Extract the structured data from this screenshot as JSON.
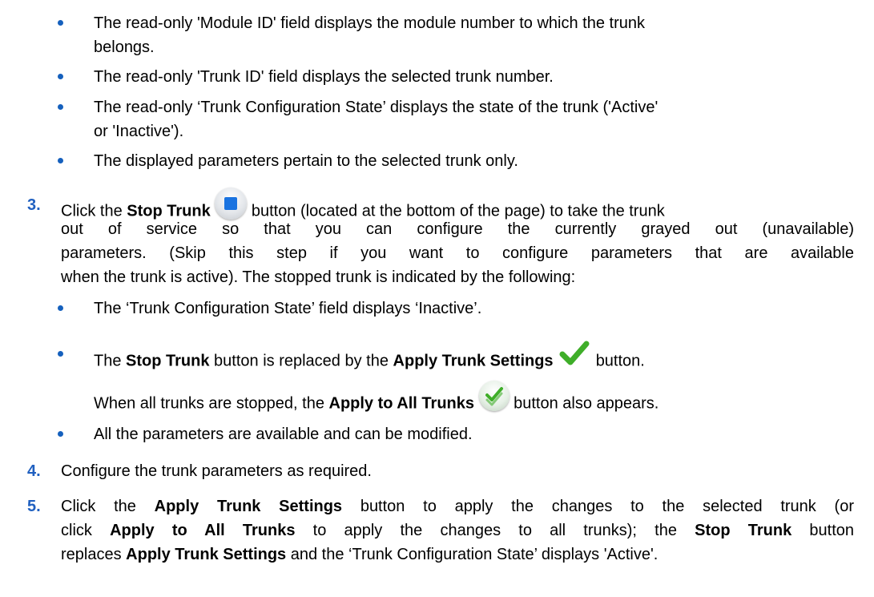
{
  "step2_bullets": {
    "b1_l1": "The read-only 'Module ID' field displays the module number to which the trunk",
    "b1_l2": "belongs.",
    "b2": "The read-only 'Trunk ID' field displays the selected trunk number.",
    "b3_l1": "The read-only ‘Trunk Configuration State’ displays the state of the trunk ('Active'",
    "b3_l2": "or 'Inactive').",
    "b4": "The displayed parameters pertain to the selected trunk only."
  },
  "step3": {
    "number": "3.",
    "pre": "Click the ",
    "stop_trunk": "Stop Trunk",
    "post": " button (located at the bottom of the page) to take the trunk",
    "l2": "out of service so that you can configure the currently grayed out (unavailable)",
    "l3": "parameters. (Skip this step if you want to configure parameters that are available",
    "l4": "when the trunk is active). The stopped trunk is indicated by the following:",
    "b1": "The ‘Trunk Configuration State’ field displays ‘Inactive’.",
    "b2_a": "The ",
    "b2_stop": "Stop Trunk",
    "b2_b": " button is replaced by the ",
    "b2_apply": "Apply Trunk Settings",
    "b2_c": " button.",
    "b2_sub_a": "When all trunks are stopped, the ",
    "b2_sub_bold": "Apply to All Trunks",
    "b2_sub_c": " button also appears.",
    "b3": "All the parameters are available and can be modified."
  },
  "step4": {
    "number": "4.",
    "text": "Configure the trunk parameters as required."
  },
  "step5": {
    "number": "5.",
    "l1_a": "Click the ",
    "l1_b": "Apply Trunk Settings",
    "l1_c": " button to apply the changes to the selected trunk (or",
    "l2_a": "click ",
    "l2_b": "Apply to All Trunks",
    "l2_c": " to apply the changes to all trunks); the ",
    "l2_d": "Stop Trunk",
    "l2_e": " button",
    "l3_a": "replaces ",
    "l3_b": "Apply Trunk Settings",
    "l3_c": " and the ‘Trunk Configuration State’ displays 'Active'."
  },
  "colors": {
    "step_number": "#2060c0",
    "bullet": "#1560bd",
    "stop_icon": "#1a73e0",
    "check_icon": "#3fae29"
  },
  "icons": [
    "stop-trunk-icon",
    "apply-trunk-settings-icon",
    "apply-to-all-trunks-icon"
  ]
}
